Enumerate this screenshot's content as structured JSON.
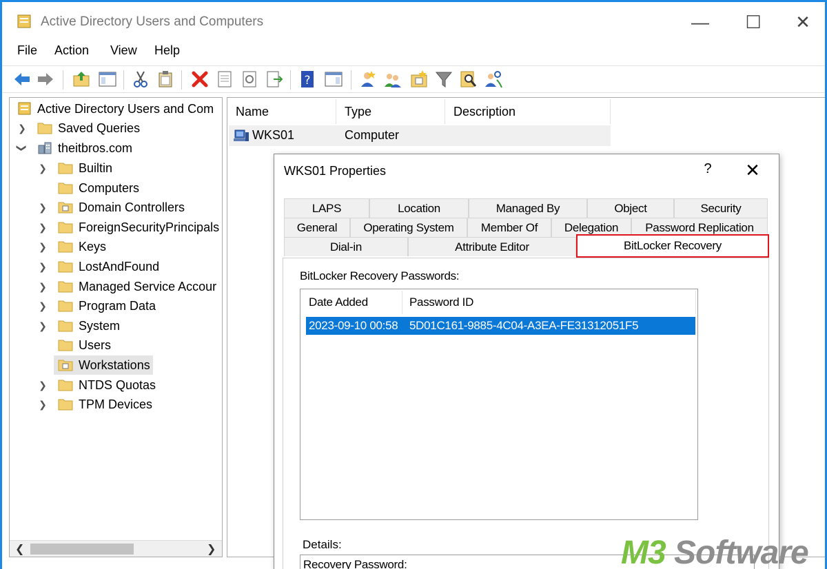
{
  "window": {
    "title": "Active Directory Users and Computers",
    "controls": {
      "minimize": "—",
      "maximize": "☐",
      "close": "✕"
    }
  },
  "menu": [
    "File",
    "Action",
    "View",
    "Help"
  ],
  "toolbar": {
    "icons": [
      "back-arrow-icon",
      "forward-arrow-icon",
      "up-folder-icon",
      "show-console-tree-icon",
      "cut-icon",
      "paste-icon",
      "delete-icon",
      "properties-icon",
      "refresh-icon",
      "export-list-icon",
      "help-icon",
      "action-pane-icon",
      "new-user-icon",
      "new-group-icon",
      "new-ou-icon",
      "filter-icon",
      "find-icon",
      "add-to-group-icon"
    ]
  },
  "tree": {
    "root": "Active Directory Users and Com",
    "saved_queries": "Saved Queries",
    "domain": "theitbros.com",
    "children": [
      {
        "label": "Builtin",
        "expandable": true,
        "ou": false
      },
      {
        "label": "Computers",
        "expandable": false,
        "ou": false
      },
      {
        "label": "Domain Controllers",
        "expandable": true,
        "ou": true
      },
      {
        "label": "ForeignSecurityPrincipals",
        "expandable": true,
        "ou": false
      },
      {
        "label": "Keys",
        "expandable": true,
        "ou": false
      },
      {
        "label": "LostAndFound",
        "expandable": true,
        "ou": false
      },
      {
        "label": "Managed Service Accour",
        "expandable": true,
        "ou": false
      },
      {
        "label": "Program Data",
        "expandable": true,
        "ou": false
      },
      {
        "label": "System",
        "expandable": true,
        "ou": false
      },
      {
        "label": "Users",
        "expandable": false,
        "ou": false
      },
      {
        "label": "Workstations",
        "expandable": false,
        "ou": true,
        "selected": true
      },
      {
        "label": "NTDS Quotas",
        "expandable": true,
        "ou": false
      },
      {
        "label": "TPM Devices",
        "expandable": true,
        "ou": false
      }
    ]
  },
  "list": {
    "columns": [
      "Name",
      "Type",
      "Description"
    ],
    "rows": [
      {
        "name": "WKS01",
        "type": "Computer",
        "description": ""
      }
    ]
  },
  "dialog": {
    "title": "WKS01 Properties",
    "help": "?",
    "close": "✕",
    "tabs_row1": [
      "LAPS",
      "Location",
      "Managed By",
      "Object",
      "Security"
    ],
    "tabs_row2": [
      "General",
      "Operating System",
      "Member Of",
      "Delegation",
      "Password Replication"
    ],
    "tabs_row3": [
      "Dial-in",
      "Attribute Editor",
      "BitLocker Recovery"
    ],
    "active_tab": "BitLocker Recovery",
    "recovery_label": "BitLocker Recovery Passwords:",
    "pw_columns": [
      "Date Added",
      "Password ID"
    ],
    "pw_rows": [
      {
        "date": "2023-09-10 00:58",
        "id": "5D01C161-9885-4C04-A3EA-FE31312051F5"
      }
    ],
    "details_label": "Details:",
    "details_text": "Recovery Password:"
  },
  "watermark": {
    "part1": "M3",
    "part2": " Software"
  },
  "colors": {
    "window_border": "#1e88e5",
    "selection": "#0a78d7",
    "highlight_box": "#e0151b",
    "folder": "#f3d071",
    "watermark_green": "#7bc243"
  }
}
